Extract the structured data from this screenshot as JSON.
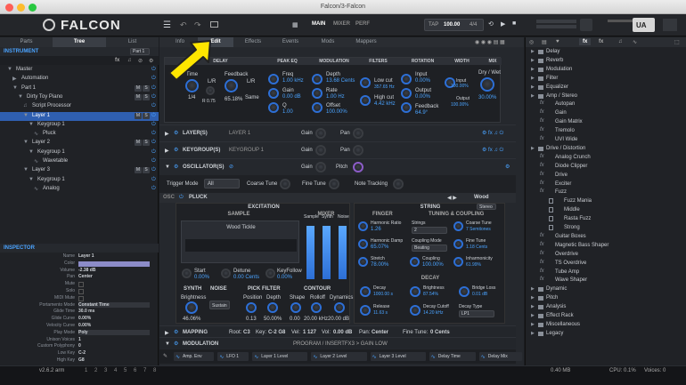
{
  "window": {
    "title": "Falcon/3-Falcon"
  },
  "toolbar": {
    "logo": "FALCON",
    "views": [
      "MAIN",
      "MIXER",
      "PERF"
    ],
    "tap_label": "TAP",
    "bpm": "100.00",
    "time_sig": "4/4",
    "tune": "440.00 Hz",
    "brand": "UA"
  },
  "left": {
    "tabs": [
      "Parts",
      "Tree",
      "List"
    ],
    "section": "INSTRUMENT",
    "part_select": "Part 1",
    "tree": [
      {
        "label": "Master"
      },
      {
        "label": "Automation"
      },
      {
        "label": "Part 1"
      },
      {
        "label": "Dirty Toy Piano"
      },
      {
        "label": "Script Processor"
      },
      {
        "label": "Layer 1"
      },
      {
        "label": "Keygroup 1"
      },
      {
        "label": "Pluck"
      },
      {
        "label": "Layer 2"
      },
      {
        "label": "Keygroup 1"
      },
      {
        "label": "Wavetable"
      },
      {
        "label": "Layer 3"
      },
      {
        "label": "Keygroup 1"
      },
      {
        "label": "Analog"
      }
    ],
    "inspector_title": "INSPECTOR",
    "props": [
      {
        "k": "Name",
        "v": "Layer 1"
      },
      {
        "k": "Color",
        "v": ""
      },
      {
        "k": "Volume",
        "v": "-2.38 dB"
      },
      {
        "k": "Pan",
        "v": "Center"
      },
      {
        "k": "Mute",
        "v": ""
      },
      {
        "k": "Solo",
        "v": ""
      },
      {
        "k": "MIDI Mute",
        "v": ""
      },
      {
        "k": "Portamento Mode",
        "v": "Constant Time"
      },
      {
        "k": "Glide Time",
        "v": "30.0 ms"
      },
      {
        "k": "Glide Curve",
        "v": "0.00%"
      },
      {
        "k": "Velocity Curve",
        "v": "0.00%"
      },
      {
        "k": "Play Mode",
        "v": "Poly"
      },
      {
        "k": "Unison Voices",
        "v": "1"
      },
      {
        "k": "Custom Polyphony",
        "v": "0"
      },
      {
        "k": "Low Key",
        "v": "C-2"
      },
      {
        "k": "High Key",
        "v": "G8"
      }
    ],
    "version": "v2.6.2 arm",
    "pages": [
      "1",
      "2",
      "3",
      "4",
      "5",
      "6",
      "7",
      "8"
    ]
  },
  "center": {
    "tabs": [
      "Info",
      "Edit",
      "Effects",
      "Events",
      "Mods",
      "Mappers"
    ],
    "fx_header": [
      "DELAY",
      "PEAK EQ",
      "MODULATION",
      "FILTERS",
      "ROTATION",
      "WIDTH",
      "MIX"
    ],
    "fx_params": {
      "time": "Time",
      "time_val": "1/4",
      "lr": "L/R",
      "ratio": "R 0.75",
      "feedback": "Feedback",
      "feedback_val": "65.18%",
      "lr2": "L/R",
      "same": "Same",
      "freq": "Freq",
      "freq_val": "1.00 kHz",
      "gain": "Gain",
      "gain_val": "0.00 dB",
      "q": "Q",
      "q_val": "1.00",
      "depth": "Depth",
      "depth_val": "13.68 Cents",
      "rate": "Rate",
      "rate_val": "1.00 Hz",
      "offset": "Offset",
      "offset_val": "100.00%",
      "lowcut": "Low cut",
      "lowcut_val": "357.65 Hz",
      "highcut": "High cut",
      "highcut_val": "4.42 kHz",
      "input": "Input",
      "input_val": "0.00%",
      "output": "Output",
      "output_val": "0.00%",
      "feedback2": "Feedback",
      "feedback2_val": "64.9°",
      "winput": "Input",
      "winput_val": "100.00%",
      "woutput": "Output",
      "woutput_val": "100.00%",
      "drywet": "Dry / Wet",
      "drywet_val": "30.00%"
    },
    "layer_row": {
      "label": "LAYER(S)",
      "name": "LAYER 1",
      "gain": "Gain",
      "pan": "Pan"
    },
    "keygroup_row": {
      "label": "KEYGROUP(S)",
      "name": "KEYGROUP 1",
      "gain": "Gain",
      "pan": "Pan"
    },
    "osc_row": {
      "label": "OSCILLATOR(S)",
      "gain": "Gain",
      "pitch": "Pitch"
    },
    "trig": {
      "label": "Trigger Mode",
      "value": "All",
      "coarse": "Coarse Tune",
      "fine": "Fine Tune",
      "note": "Note Tracking"
    },
    "osc_bar": {
      "osc": "OSC",
      "name": "PLUCK",
      "wood": "Wood",
      "stereo": "Stereo"
    },
    "excitation": {
      "title": "EXCITATION",
      "sample": "SAMPLE",
      "mixer": "MIXER",
      "sample_name": "Wood Tickle",
      "mix_cols": [
        "Sample",
        "Synth",
        "Noise"
      ],
      "start": "Start",
      "start_val": "0.00%",
      "detune": "Detune",
      "detune_val": "0.00 Cents",
      "keyfollow": "KeyFollow",
      "keyfollow_val": "0.00%",
      "synth": "SYNTH",
      "noise": "NOISE",
      "pickfilter": "PICK FILTER",
      "contour": "CONTOUR",
      "brightness": "Brightness",
      "brightness_val": "46.06%",
      "sustain": "Sustain",
      "position": "Position",
      "position_val": "0.13",
      "depth": "Depth",
      "depth_val": "50.00%",
      "shape": "Shape",
      "shape_val": "0.00",
      "rolloff": "Rolloff",
      "rolloff_val": "20.00 kHz",
      "dynamics": "Dynamics",
      "dynamics_val": "20.00 dB"
    },
    "string": {
      "title": "STRING",
      "finger": "FINGER",
      "tuning": "TUNING & COUPLING",
      "harm_ratio": "Harmonic Ratio",
      "harm_ratio_val": "1.26",
      "strings": "Strings",
      "strings_val": "2",
      "coarse": "Coarse Tune",
      "coarse_val": "7 Semitones",
      "harm_damp": "Harmonic Damp",
      "harm_damp_val": "65.07%",
      "coupling_mode": "Coupling Mode",
      "coupling_mode_val": "Beating",
      "fine": "Fine Tune",
      "fine_val": "1.18 Cents",
      "stretch": "Stretch",
      "stretch_val": "78.00%",
      "coupling": "Coupling",
      "coupling_val": "100.00%",
      "inharm": "Inharmonicity",
      "inharm_val": "61.99%",
      "decay_title": "DECAY",
      "decay": "Decay",
      "decay_val": "1000.00 s",
      "brightness": "Brightness",
      "brightness_val": "87.54%",
      "bridge": "Bridge Loss",
      "bridge_val": "0.01 dB",
      "release": "Release",
      "release_val": "11.63 s",
      "decay_cutoff": "Decay Cutoff",
      "decay_cutoff_val": "14.20 kHz",
      "decay_type": "Decay Type",
      "decay_type_val": "LP1"
    },
    "mapping": {
      "label": "MAPPING",
      "root": "Root:",
      "root_val": "C3",
      "key": "Key:",
      "key_val": "C-2 G8",
      "vel": "Vel:",
      "vel_val": "1 127",
      "vol": "Vol:",
      "vol_val": "0.00 dB",
      "pan": "Pan:",
      "pan_val": "Center",
      "fine": "Fine Tune:",
      "fine_val": "0 Cents"
    },
    "modulation": {
      "label": "MODULATION",
      "path": "PROGRAM / INSERTFX3 > GAIN LOW",
      "chips": [
        "Amp. Env",
        "LFO 1",
        "Layer 1 Level",
        "Layer 2 Level",
        "Layer 3 Level",
        "Delay Time",
        "Delay Mix"
      ]
    }
  },
  "right": {
    "tune": "440.00 Hz",
    "items": [
      {
        "label": "Delay",
        "lvl": 0
      },
      {
        "label": "Reverb",
        "lvl": 0
      },
      {
        "label": "Modulation",
        "lvl": 0
      },
      {
        "label": "Filter",
        "lvl": 0
      },
      {
        "label": "Equalizer",
        "lvl": 0
      },
      {
        "label": "Amp / Stereo",
        "lvl": 0
      },
      {
        "label": "Autopan",
        "lvl": 1
      },
      {
        "label": "Gain",
        "lvl": 1
      },
      {
        "label": "Gain Matrix",
        "lvl": 1
      },
      {
        "label": "Tremolo",
        "lvl": 1
      },
      {
        "label": "UVI Wide",
        "lvl": 1
      },
      {
        "label": "Drive / Distortion",
        "lvl": 0
      },
      {
        "label": "Analog Crunch",
        "lvl": 1
      },
      {
        "label": "Diode Clipper",
        "lvl": 1
      },
      {
        "label": "Drive",
        "lvl": 1
      },
      {
        "label": "Exciter",
        "lvl": 1
      },
      {
        "label": "Fuzz",
        "lvl": 1
      },
      {
        "label": "Fuzz Mania",
        "lvl": 2
      },
      {
        "label": "Middle",
        "lvl": 2
      },
      {
        "label": "Rasta Fuzz",
        "lvl": 2
      },
      {
        "label": "Strong",
        "lvl": 2
      },
      {
        "label": "Guitar Boxes",
        "lvl": 1
      },
      {
        "label": "Magnetic Bass Shaper",
        "lvl": 1
      },
      {
        "label": "Overdrive",
        "lvl": 1
      },
      {
        "label": "TS Overdrive",
        "lvl": 1
      },
      {
        "label": "Tube Amp",
        "lvl": 1
      },
      {
        "label": "Wave Shaper",
        "lvl": 1
      },
      {
        "label": "Dynamic",
        "lvl": 0
      },
      {
        "label": "Pitch",
        "lvl": 0
      },
      {
        "label": "Analysis",
        "lvl": 0
      },
      {
        "label": "Effect Rack",
        "lvl": 0
      },
      {
        "label": "Miscellaneous",
        "lvl": 0
      },
      {
        "label": "Legacy",
        "lvl": 0
      }
    ]
  },
  "status": {
    "mem": "0.40 MB",
    "cpu": "CPU: 0.1%",
    "voices": "Voices: 0"
  },
  "colors": {
    "accent": "#2d6fd6",
    "arrow": "#ffe600",
    "layer_color": "#8c8cc8"
  }
}
